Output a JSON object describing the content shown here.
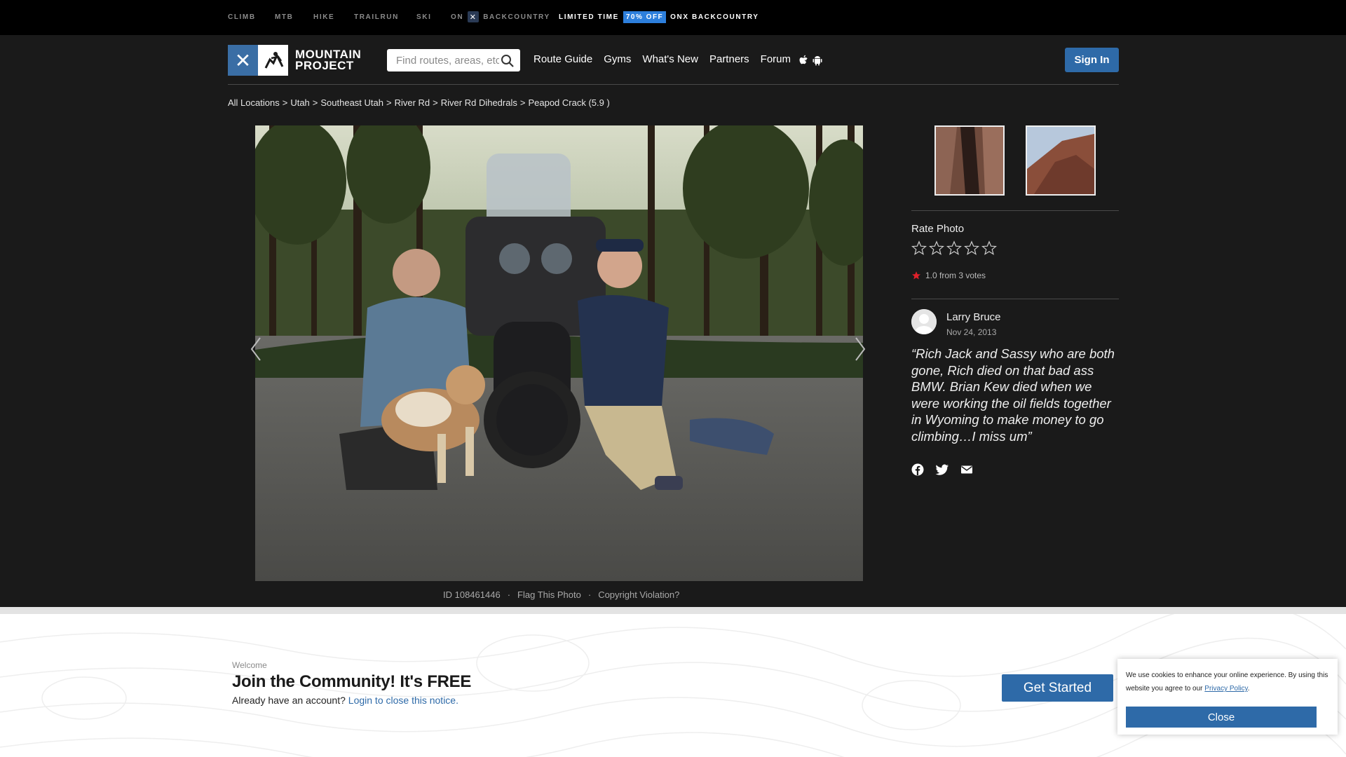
{
  "topbar": {
    "items": [
      "CLIMB",
      "MTB",
      "HIKE",
      "TRAILRUN",
      "SKI"
    ],
    "on_label": "ON",
    "backcountry": "BACKCOUNTRY",
    "promo_prefix": "LIMITED TIME",
    "promo_badge": "70% OFF",
    "promo_suffix": "ONX BACKCOUNTRY"
  },
  "header": {
    "logo_line1": "MOUNTAIN",
    "logo_line2": "PROJECT",
    "search_placeholder": "Find routes, areas, etc",
    "nav": [
      "Route Guide",
      "Gyms",
      "What's New",
      "Partners",
      "Forum"
    ],
    "signin": "Sign In"
  },
  "breadcrumb": [
    "All Locations",
    "Utah",
    "Southeast Utah",
    "River Rd",
    "River Rd Dihedrals",
    "Peapod Crack (5.9 )"
  ],
  "photo": {
    "id_label": "ID 108461446",
    "flag": "Flag This Photo",
    "copyright": "Copyright Violation?"
  },
  "rating": {
    "title": "Rate Photo",
    "stars_total": 5,
    "summary": "1.0 from 3 votes"
  },
  "comment": {
    "author": "Larry Bruce",
    "date": "Nov 24, 2013",
    "quote": "“Rich Jack and Sassy who are both gone, Rich died on that bad ass BMW. Brian Kew died when we were working the oil fields together in Wyoming to make money to go climbing…I miss um”"
  },
  "community": {
    "welcome": "Welcome",
    "headline": "Join the Community! It's FREE",
    "account_prefix": "Already have an account?",
    "login_link": "Login to close this notice.",
    "cta": "Get Started"
  },
  "cookie": {
    "text": "We use cookies to enhance your online experience. By using this website you agree to our",
    "policy_link": "Privacy Policy",
    "close": "Close"
  },
  "colors": {
    "brand_blue": "#2e6aa8",
    "promo_badge": "#2d7fdc",
    "rating_star": "#e0202a"
  }
}
